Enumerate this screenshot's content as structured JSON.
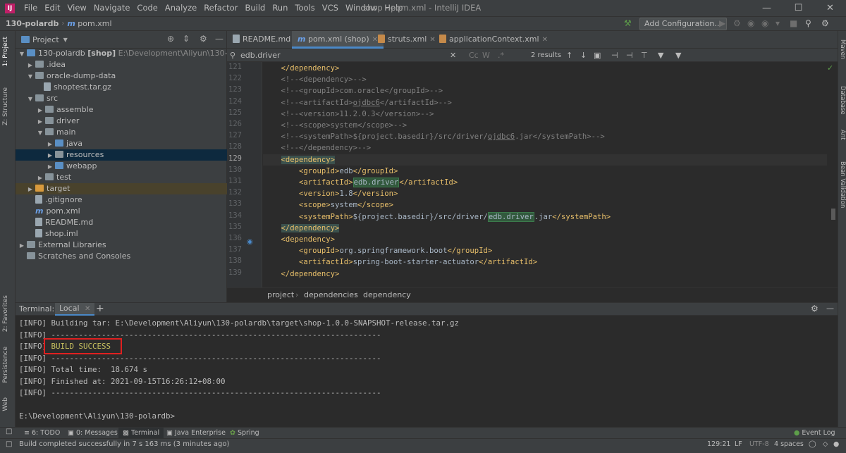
{
  "window": {
    "title": "shop - pom.xml - IntelliJ IDEA",
    "menu": [
      "File",
      "Edit",
      "View",
      "Navigate",
      "Code",
      "Analyze",
      "Refactor",
      "Build",
      "Run",
      "Tools",
      "VCS",
      "Window",
      "Help"
    ]
  },
  "navbar": {
    "project": "130-polardb",
    "file": "pom.xml",
    "add_config": "Add Configuration..."
  },
  "left_strip": [
    "1: Project",
    "Z: Structure",
    "2: Favorites",
    "Persistence",
    "Web"
  ],
  "right_strip": [
    "Maven",
    "Database",
    "Ant",
    "Bean Validation"
  ],
  "project_panel": {
    "title": "Project",
    "tree": [
      {
        "label": "130-polardb",
        "bold_suffix": "[shop]",
        "path": "E:\\Development\\Aliyun\\130-polardb"
      },
      {
        "label": ".idea"
      },
      {
        "label": "oracle-dump-data"
      },
      {
        "label": "shoptest.tar.gz"
      },
      {
        "label": "src"
      },
      {
        "label": "assemble"
      },
      {
        "label": "driver"
      },
      {
        "label": "main"
      },
      {
        "label": "java"
      },
      {
        "label": "resources"
      },
      {
        "label": "webapp"
      },
      {
        "label": "test"
      },
      {
        "label": "target"
      },
      {
        "label": ".gitignore"
      },
      {
        "label": "pom.xml"
      },
      {
        "label": "README.md"
      },
      {
        "label": "shop.iml"
      },
      {
        "label": "External Libraries"
      },
      {
        "label": "Scratches and Consoles"
      }
    ]
  },
  "editor_tabs": [
    {
      "label": "README.md"
    },
    {
      "label": "pom.xml (shop)"
    },
    {
      "label": "struts.xml"
    },
    {
      "label": "applicationContext.xml"
    }
  ],
  "search": {
    "query": "edb.driver",
    "results": "2 results"
  },
  "line_numbers": [
    "121",
    "122",
    "123",
    "124",
    "125",
    "126",
    "127",
    "128",
    "129",
    "130",
    "131",
    "132",
    "133",
    "134",
    "135",
    "136",
    "137",
    "138",
    "139"
  ],
  "code": [
    {
      "pre": "    ",
      "parts": [
        [
          "tag",
          "</dependency>"
        ]
      ]
    },
    {
      "pre": "    ",
      "parts": [
        [
          "cmt",
          "<!--<dependency>-->"
        ]
      ]
    },
    {
      "pre": "    ",
      "parts": [
        [
          "cmt",
          "<!--<groupId>com.oracle</groupId>-->"
        ]
      ]
    },
    {
      "pre": "    ",
      "parts": [
        [
          "cmt",
          "<!--<artifactId>"
        ],
        [
          "cmtul",
          "ojdbc6"
        ],
        [
          "cmt",
          "</artifactId>-->"
        ]
      ]
    },
    {
      "pre": "    ",
      "parts": [
        [
          "cmt",
          "<!--<version>11.2.0.3</version>-->"
        ]
      ]
    },
    {
      "pre": "    ",
      "parts": [
        [
          "cmt",
          "<!--<scope>system</scope>-->"
        ]
      ]
    },
    {
      "pre": "    ",
      "parts": [
        [
          "cmt",
          "<!--<systemPath>${project.basedir}/src/driver/"
        ],
        [
          "cmtul",
          "ojdbc6"
        ],
        [
          "cmt",
          ".jar</systemPath>-->"
        ]
      ]
    },
    {
      "pre": "    ",
      "parts": [
        [
          "cmt",
          "<!--</dependency>-->"
        ]
      ]
    },
    {
      "pre": "    ",
      "parts": [
        [
          "tagbox",
          "<dependency>"
        ]
      ]
    },
    {
      "pre": "        ",
      "parts": [
        [
          "tag",
          "<groupId>"
        ],
        [
          "txt",
          "edb"
        ],
        [
          "tag",
          "</groupId>"
        ]
      ]
    },
    {
      "pre": "        ",
      "parts": [
        [
          "tag",
          "<artifactId>"
        ],
        [
          "match",
          "edb.driver"
        ],
        [
          "tag",
          "</artifactId>"
        ]
      ]
    },
    {
      "pre": "        ",
      "parts": [
        [
          "tag",
          "<version>"
        ],
        [
          "txt",
          "1.8"
        ],
        [
          "tag",
          "</version>"
        ]
      ]
    },
    {
      "pre": "        ",
      "parts": [
        [
          "tag",
          "<scope>"
        ],
        [
          "txt",
          "system"
        ],
        [
          "tag",
          "</scope>"
        ]
      ]
    },
    {
      "pre": "        ",
      "parts": [
        [
          "tag",
          "<systemPath>"
        ],
        [
          "txt",
          "${project.basedir}/src/driver/"
        ],
        [
          "match",
          "edb.driver"
        ],
        [
          "txt",
          ".jar"
        ],
        [
          "tag",
          "</systemPath>"
        ]
      ]
    },
    {
      "pre": "    ",
      "parts": [
        [
          "tagbox",
          "</dependency>"
        ]
      ]
    },
    {
      "pre": "    ",
      "parts": [
        [
          "tag",
          "<dependency>"
        ]
      ]
    },
    {
      "pre": "        ",
      "parts": [
        [
          "tag",
          "<groupId>"
        ],
        [
          "txt",
          "org.springframework.boot"
        ],
        [
          "tag",
          "</groupId>"
        ]
      ]
    },
    {
      "pre": "        ",
      "parts": [
        [
          "tag",
          "<artifactId>"
        ],
        [
          "txt",
          "spring-boot-starter-actuator"
        ],
        [
          "tag",
          "</artifactId>"
        ]
      ]
    },
    {
      "pre": "    ",
      "parts": [
        [
          "tag",
          "</dependency>"
        ]
      ]
    }
  ],
  "breadcrumbs": [
    "project",
    "dependencies",
    "dependency"
  ],
  "terminal": {
    "label": "Terminal:",
    "tab": "Local",
    "lines": [
      "[INFO] Building tar: E:\\Development\\Aliyun\\130-polardb\\target\\shop-1.0.0-SNAPSHOT-release.tar.gz",
      "[INFO] ------------------------------------------------------------------------",
      "[INFO] ",
      "[INFO] ------------------------------------------------------------------------",
      "[INFO] Total time:  18.674 s",
      "[INFO] Finished at: 2021-09-15T16:26:12+08:00",
      "[INFO] ------------------------------------------------------------------------",
      "",
      "E:\\Development\\Aliyun\\130-polardb>"
    ],
    "success": "BUILD SUCCESS"
  },
  "bottom_tools": [
    "6: TODO",
    "0: Messages",
    "Terminal",
    "Java Enterprise",
    "Spring",
    "Event Log"
  ],
  "status": {
    "message": "Build completed successfully in 7 s 163 ms (3 minutes ago)",
    "position": "129:21",
    "line_sep": "LF",
    "encoding": "UTF-8",
    "indent": "4 spaces"
  },
  "colors": {
    "accent": "#4a88c7",
    "build_success": "#c7c05f",
    "highlight_box": "#e02020",
    "tag": "#e8bf6a",
    "comment": "#808080"
  }
}
